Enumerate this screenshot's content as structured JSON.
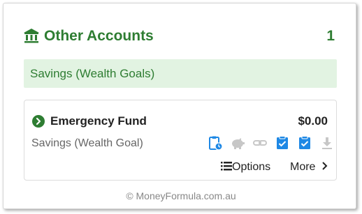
{
  "section": {
    "title": "Other Accounts",
    "count": "1",
    "icon": "bank-icon"
  },
  "category": {
    "label": "Savings (Wealth Goals)"
  },
  "account": {
    "name": "Emergency Fund",
    "balance": "$0.00",
    "type": "Savings (Wealth Goal)",
    "action_icons": [
      "clipboard-clock-icon",
      "piggy-bank-icon",
      "link-icon",
      "clipboard-check-icon",
      "clipboard-check-icon",
      "download-icon"
    ],
    "options_label": "Options",
    "more_label": "More"
  },
  "footer": {
    "text": "© MoneyFormula.com.au"
  },
  "colors": {
    "brand_green": "#2e7d32",
    "category_bg": "#e2f3e2",
    "icon_blue": "#1e88e5",
    "icon_grey": "#c7c7c7"
  }
}
